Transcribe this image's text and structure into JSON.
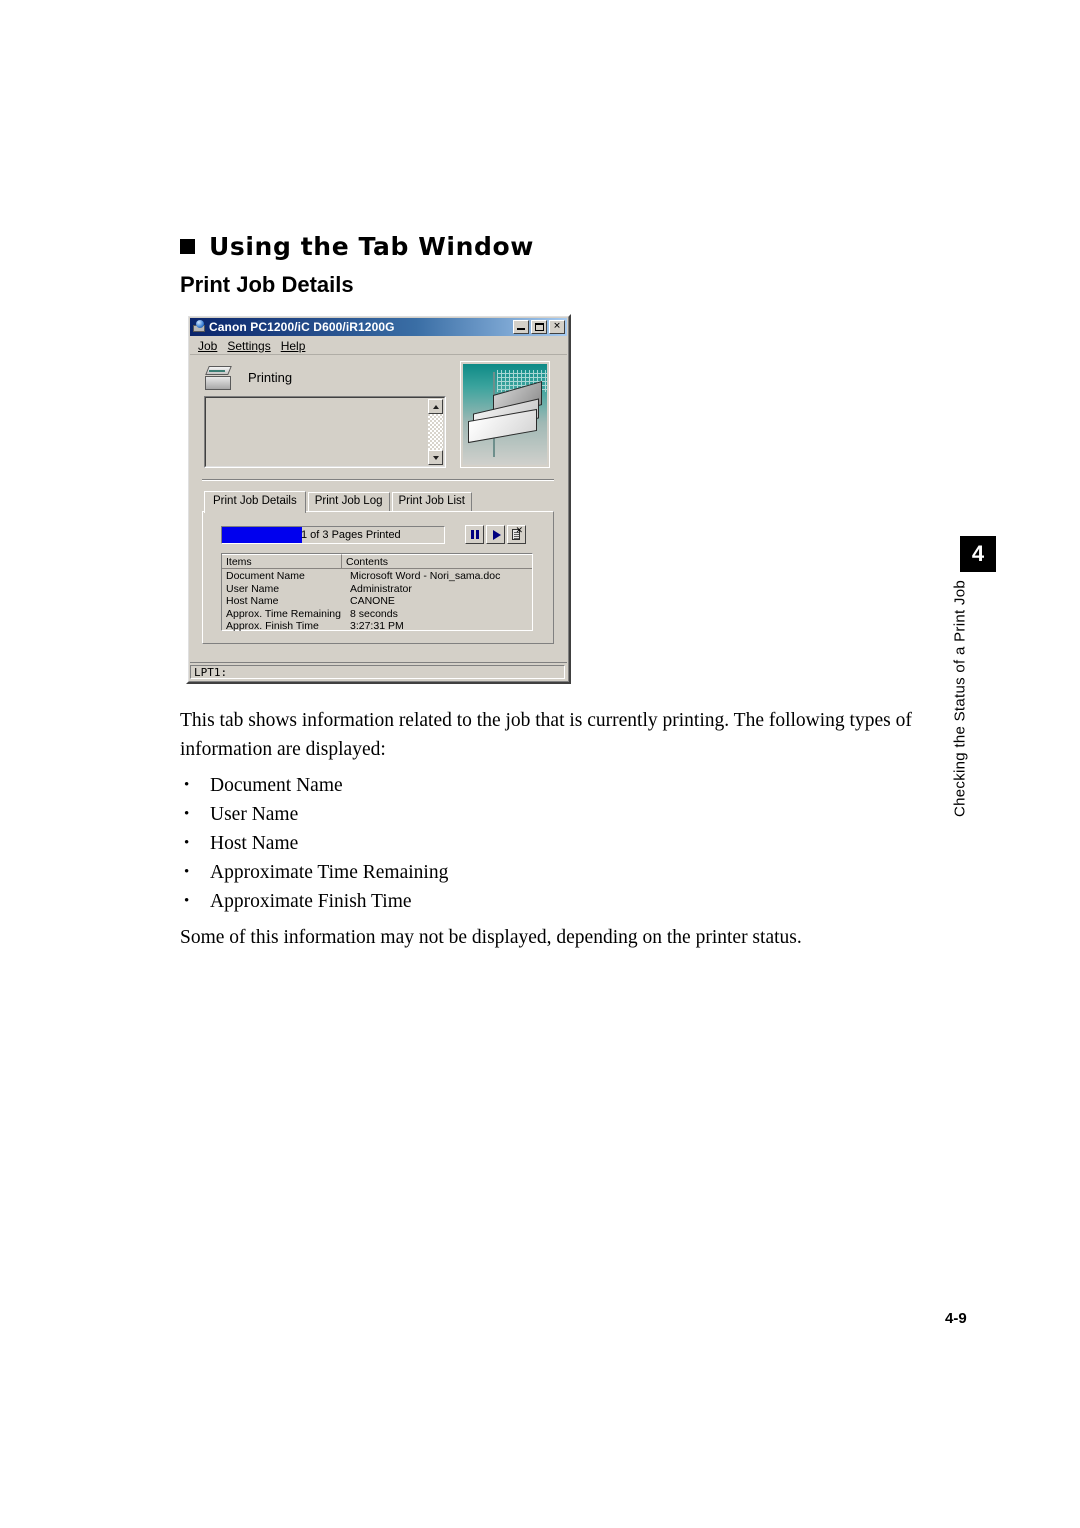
{
  "document": {
    "heading": "Using the Tab Window",
    "subheading": "Print Job Details",
    "intro": "This tab shows information related to the job that is currently printing. The following types of information are displayed:",
    "bullets": [
      "Document Name",
      "User Name",
      "Host Name",
      "Approximate Time Remaining",
      "Approximate Finish Time"
    ],
    "closing": "Some of this information may not be displayed, depending on the printer status.",
    "page_number": "4-9",
    "chapter_number": "4",
    "chapter_label": "Checking the Status of a Print Job"
  },
  "window": {
    "title": "Canon PC1200/iC D600/iR1200G",
    "title_icon": "printer-globe-icon",
    "controls": {
      "minimize": "_",
      "maximize": "□",
      "close": "✕"
    },
    "menu": [
      {
        "label": "Job",
        "accel": "J"
      },
      {
        "label": "Settings",
        "accel": "S"
      },
      {
        "label": "Help",
        "accel": "H"
      }
    ],
    "status": {
      "icon": "printer-icon",
      "text": "Printing",
      "message_box_value": ""
    },
    "animation": {
      "alt": "paper-ejecting-animation",
      "gradient_top": "#0e8a86",
      "gradient_bottom": "#d0d0cc"
    },
    "tabs": [
      {
        "label": "Print Job Details",
        "active": true
      },
      {
        "label": "Print Job Log",
        "active": false
      },
      {
        "label": "Print Job List",
        "active": false
      }
    ],
    "progress": {
      "text": "1 of 3 Pages Printed",
      "percent": 36,
      "fill_color": "#0000ee",
      "pages_printed": 1,
      "pages_total": 3
    },
    "job_buttons": [
      {
        "name": "pause-job-button",
        "icon": "pause-icon"
      },
      {
        "name": "resume-job-button",
        "icon": "play-icon"
      },
      {
        "name": "delete-job-button",
        "icon": "document-cancel-icon"
      }
    ],
    "list": {
      "headers": [
        "Items",
        "Contents"
      ],
      "rows": [
        {
          "item": "Document Name",
          "content": "Microsoft Word - Nori_sama.doc"
        },
        {
          "item": "User Name",
          "content": "Administrator"
        },
        {
          "item": "Host Name",
          "content": "CANONE"
        },
        {
          "item": "Approx. Time Remaining",
          "content": "8  seconds"
        },
        {
          "item": "Approx. Finish Time",
          "content": "3:27:31 PM"
        }
      ]
    },
    "statusbar": {
      "port": "LPT1:"
    }
  }
}
